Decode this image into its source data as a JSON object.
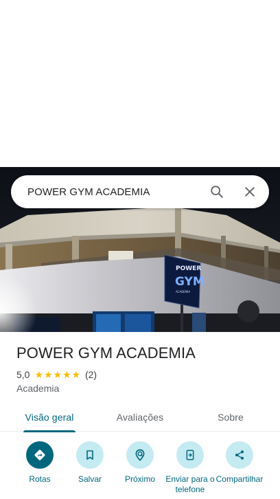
{
  "search": {
    "query": "POWER GYM ACADEMIA"
  },
  "place": {
    "name": "POWER GYM ACADEMIA",
    "rating": "5,0",
    "stars": 5,
    "review_count": "(2)",
    "category": "Academia"
  },
  "photo": {
    "sign_text_top": "POWER",
    "sign_text_main": "GYM",
    "sign_text_sub": "ACADEMIA"
  },
  "tabs": [
    {
      "label": "Visão geral",
      "active": true
    },
    {
      "label": "Avaliações",
      "active": false
    },
    {
      "label": "Sobre",
      "active": false
    }
  ],
  "actions": [
    {
      "label": "Rotas",
      "icon": "directions-icon"
    },
    {
      "label": "Salvar",
      "icon": "bookmark-icon"
    },
    {
      "label": "Próximo",
      "icon": "nearby-icon"
    },
    {
      "label": "Enviar para o telefone",
      "icon": "send-to-phone-icon"
    },
    {
      "label": "Compartilhar",
      "icon": "share-icon"
    }
  ],
  "colors": {
    "accent": "#00677d",
    "action_bg": "#c4eaf2",
    "star": "#fbbc04"
  }
}
